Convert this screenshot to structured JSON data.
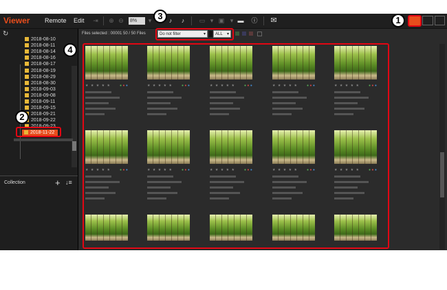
{
  "app": {
    "title": "Viewer"
  },
  "menu": {
    "remote": "Remote",
    "edit": "Edit"
  },
  "toolbar": {
    "zoom_value": "8%"
  },
  "tree": {
    "folders": [
      "2018-08-10",
      "2018-08-11",
      "2018-08-14",
      "2018-08-16",
      "2018-08-17",
      "2018-08-19",
      "2018-08-29",
      "2018-08-30",
      "2018-09-03",
      "2018-09-08",
      "2018-09-11",
      "2018-09-15",
      "2018-09-21",
      "2018-09-22",
      "2018-09-23"
    ],
    "selected_folder": "2018-11-22"
  },
  "collection": {
    "label": "Collection"
  },
  "main": {
    "files_selected": "Files selected : 00001   50 / 50 Files",
    "filter": {
      "value": "Do not filter"
    },
    "rating": {
      "value": "ALL"
    }
  },
  "callouts": [
    "1",
    "2",
    "3",
    "4"
  ],
  "colors": {
    "accent": "#e84d1c",
    "callout": "#e30613",
    "folder": "#e8b838"
  },
  "icons": [
    "refresh-icon",
    "folder-icon",
    "plus-icon",
    "sort-icon",
    "grid-view-icon",
    "list-view-icon",
    "compare-view-icon",
    "mail-icon",
    "info-icon",
    "image-icon"
  ]
}
